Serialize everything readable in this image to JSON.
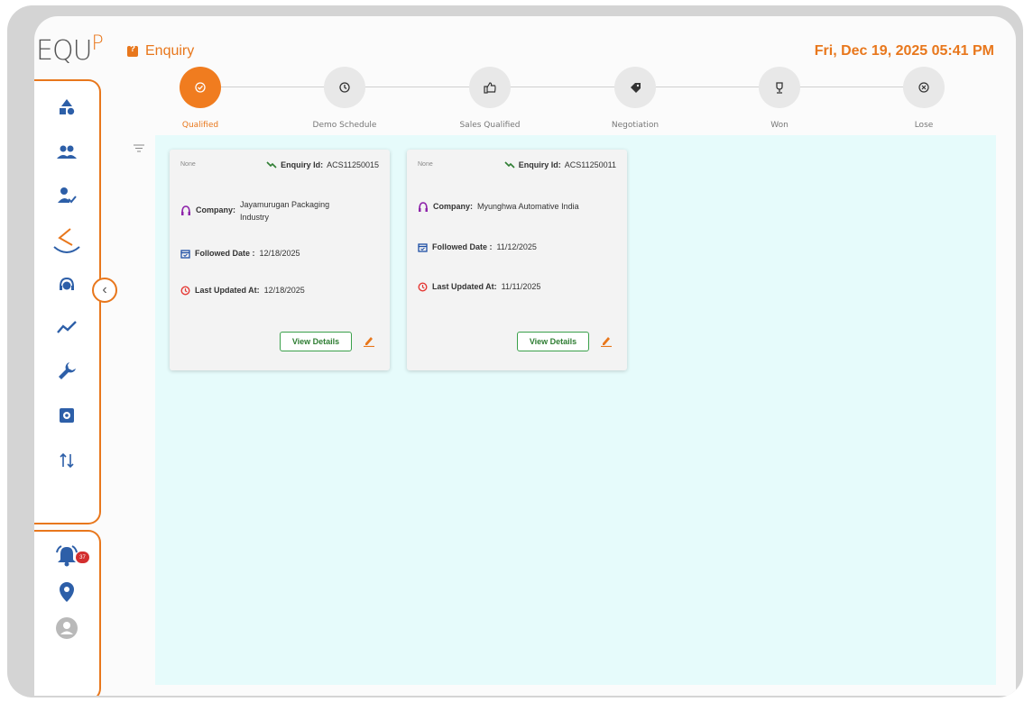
{
  "app": {
    "logo_text": "EQU",
    "logo_accent": "P"
  },
  "header": {
    "title": "Enquiry",
    "datetime": "Fri, Dec 19, 2025 05:41 PM"
  },
  "stages": [
    {
      "label": "Qualified",
      "icon": "check-circle-icon",
      "active": true
    },
    {
      "label": "Demo Schedule",
      "icon": "clock-icon",
      "active": false
    },
    {
      "label": "Sales Qualified",
      "icon": "thumbs-up-icon",
      "active": false
    },
    {
      "label": "Negotiation",
      "icon": "tag-icon",
      "active": false
    },
    {
      "label": "Won",
      "icon": "trophy-icon",
      "active": false
    },
    {
      "label": "Lose",
      "icon": "cancel-circle-icon",
      "active": false
    }
  ],
  "sidebar": {
    "items": [
      {
        "name": "shapes-icon"
      },
      {
        "name": "people-icon"
      },
      {
        "name": "person-check-icon"
      },
      {
        "name": "brand-logo-icon"
      },
      {
        "name": "support-agent-icon"
      },
      {
        "name": "trend-icon"
      },
      {
        "name": "wrench-icon"
      },
      {
        "name": "settings-box-icon"
      },
      {
        "name": "sort-arrows-icon"
      }
    ],
    "notification_count": "37",
    "collapse_label": "‹"
  },
  "cards": [
    {
      "tag": "None",
      "enquiry_label": "Enquiry Id:",
      "enquiry_id": "ACS11250015",
      "company_label": "Company:",
      "company": "Jayamurugan Packaging Industry",
      "followed_label": "Followed Date :",
      "followed_date": "12/18/2025",
      "updated_label": "Last Updated At:",
      "updated_at": "12/18/2025",
      "view_label": "View Details"
    },
    {
      "tag": "None",
      "enquiry_label": "Enquiry Id:",
      "enquiry_id": "ACS11250011",
      "company_label": "Company:",
      "company": "Myunghwa Automative India",
      "followed_label": "Followed Date :",
      "followed_date": "11/12/2025",
      "updated_label": "Last Updated At:",
      "updated_at": "11/11/2025",
      "view_label": "View Details"
    }
  ],
  "colors": {
    "accent": "#e8771c",
    "board_bg": "#e6fbfb",
    "button_green": "#3aa04a",
    "badge_red": "#d32f2f"
  }
}
